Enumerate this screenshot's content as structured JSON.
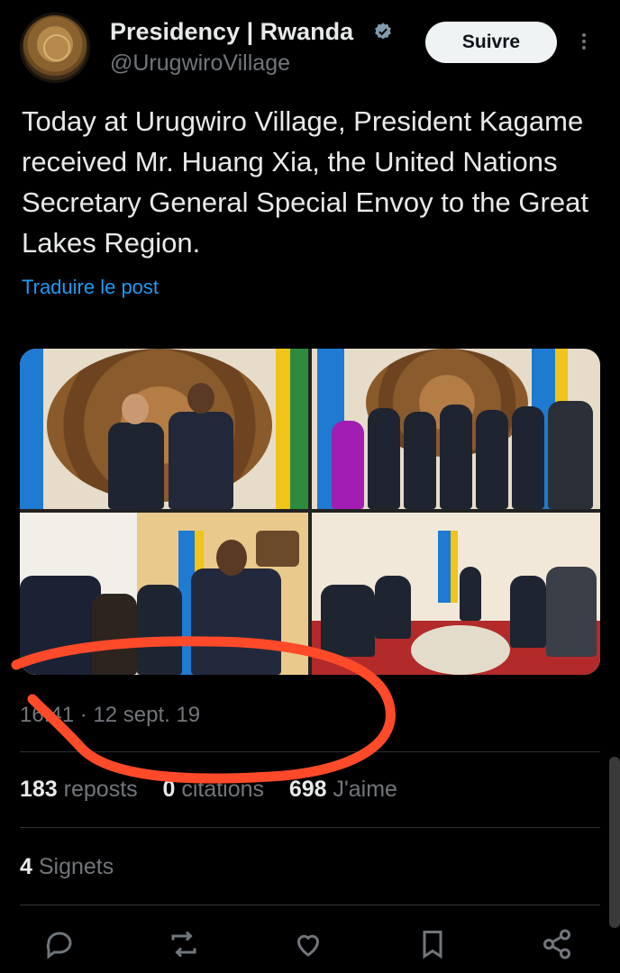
{
  "header": {
    "display_name": "Presidency | Rwanda",
    "handle": "@UrugwiroVillage",
    "follow_label": "Suivre"
  },
  "post": {
    "text": "Today at Urugwiro Village, President Kagame received Mr. Huang Xia, the United Nations Secretary General Special Envoy to the Great Lakes Region.",
    "translate_label": "Traduire le post",
    "timestamp": "16:41 · 12 sept. 19"
  },
  "stats": {
    "reposts_count": "183",
    "reposts_label": "reposts",
    "quotes_count": "0",
    "quotes_label": "citations",
    "likes_count": "698",
    "likes_label": "J'aime",
    "bookmarks_count": "4",
    "bookmarks_label": "Signets"
  },
  "icons": {
    "verified": "verified-badge-icon",
    "more": "more-vertical-icon",
    "reply": "reply-icon",
    "repost": "repost-icon",
    "like": "heart-icon",
    "bookmark": "bookmark-icon",
    "share": "share-icon"
  },
  "colors": {
    "background": "#000000",
    "primary_text": "#e7e9ea",
    "secondary_text": "#71767b",
    "link": "#1d9bf0",
    "annotation": "#ff4a2a"
  }
}
